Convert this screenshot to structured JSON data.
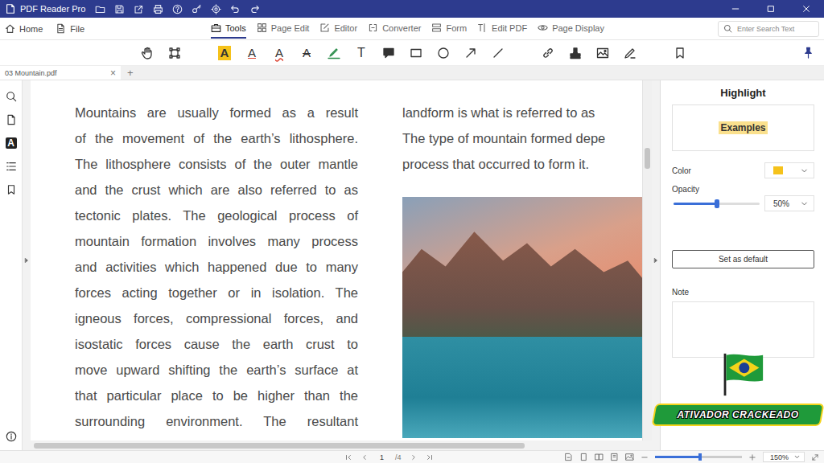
{
  "window": {
    "title": "PDF Reader Pro"
  },
  "menu": {
    "left": [
      {
        "label": "Home"
      },
      {
        "label": "File"
      }
    ],
    "tabs": [
      {
        "label": "Tools",
        "selected": true
      },
      {
        "label": "Page Edit",
        "selected": false
      },
      {
        "label": "Editor",
        "selected": false
      },
      {
        "label": "Converter",
        "selected": false
      },
      {
        "label": "Form",
        "selected": false
      },
      {
        "label": "Edit PDF",
        "selected": false
      },
      {
        "label": "Page Display",
        "selected": false
      }
    ],
    "search": {
      "placeholder": "Enter Search Text"
    }
  },
  "toolbar": {
    "groups": [
      [
        {
          "kind": "hand",
          "selected": false
        },
        {
          "kind": "select",
          "selected": false
        }
      ],
      [
        {
          "kind": "highlight",
          "glyph": "A",
          "selected": true
        },
        {
          "kind": "underline",
          "glyph": "A",
          "selected": false
        },
        {
          "kind": "squiggly",
          "glyph": "A",
          "selected": false
        },
        {
          "kind": "strike",
          "glyph": "A",
          "selected": false
        },
        {
          "kind": "freehand",
          "selected": false
        },
        {
          "kind": "text",
          "glyph": "T",
          "selected": false
        },
        {
          "kind": "note",
          "selected": false
        },
        {
          "kind": "rect",
          "selected": false
        },
        {
          "kind": "oval",
          "selected": false
        },
        {
          "kind": "arrow",
          "selected": false
        },
        {
          "kind": "line",
          "selected": false
        }
      ],
      [
        {
          "kind": "link",
          "selected": false
        },
        {
          "kind": "stamp",
          "selected": false
        },
        {
          "kind": "image",
          "selected": false
        },
        {
          "kind": "sign",
          "selected": false
        }
      ],
      [
        {
          "kind": "bookmark",
          "selected": false
        }
      ]
    ]
  },
  "file_tabs": [
    {
      "label": "03 Mountain.pdf",
      "selected": true,
      "close": "×"
    }
  ],
  "new_tab": "+",
  "rail": [
    {
      "kind": "search",
      "selected": false
    },
    {
      "kind": "page",
      "selected": false
    },
    {
      "kind": "annotations",
      "glyph": "A",
      "selected": true
    },
    {
      "kind": "list",
      "selected": false
    },
    {
      "kind": "bookmark",
      "selected": false
    }
  ],
  "document": {
    "columns": [
      {
        "lines": [
          "Mountains are usually formed as a result",
          "of the movement of the earth’s lithosphere.",
          "The lithosphere consists of the outer mantle",
          "and the crust which are also referred to as",
          "tectonic plates. The geological process of",
          "mountain formation involves many process",
          "and activities which happened due to many",
          "forces acting together or in isolation. The",
          "igneous forces, compressional forces, and",
          "isostatic forces cause the earth crust to",
          "move upward shifting the earth’s surface at",
          "that particular place to be higher than the",
          "surrounding environment. The resultant"
        ]
      },
      {
        "lines": [
          "landform is what is referred to as",
          "The type of mountain formed depe",
          "process that occurred to form it."
        ]
      }
    ]
  },
  "panel": {
    "title": "Highlight",
    "preview": "Examples",
    "color_label": "Color",
    "color": "#f5c21b",
    "opacity_label": "Opacity",
    "opacity": {
      "level": 0.5,
      "reading": "50%"
    },
    "default_button": "Set as default",
    "note_label": "Note"
  },
  "status_bar": {
    "page": "1",
    "total": "/4",
    "zoom": {
      "level": 0.52,
      "reading": "150%"
    }
  },
  "watermark": {
    "text": "ATIVADOR CRACKEADO"
  }
}
